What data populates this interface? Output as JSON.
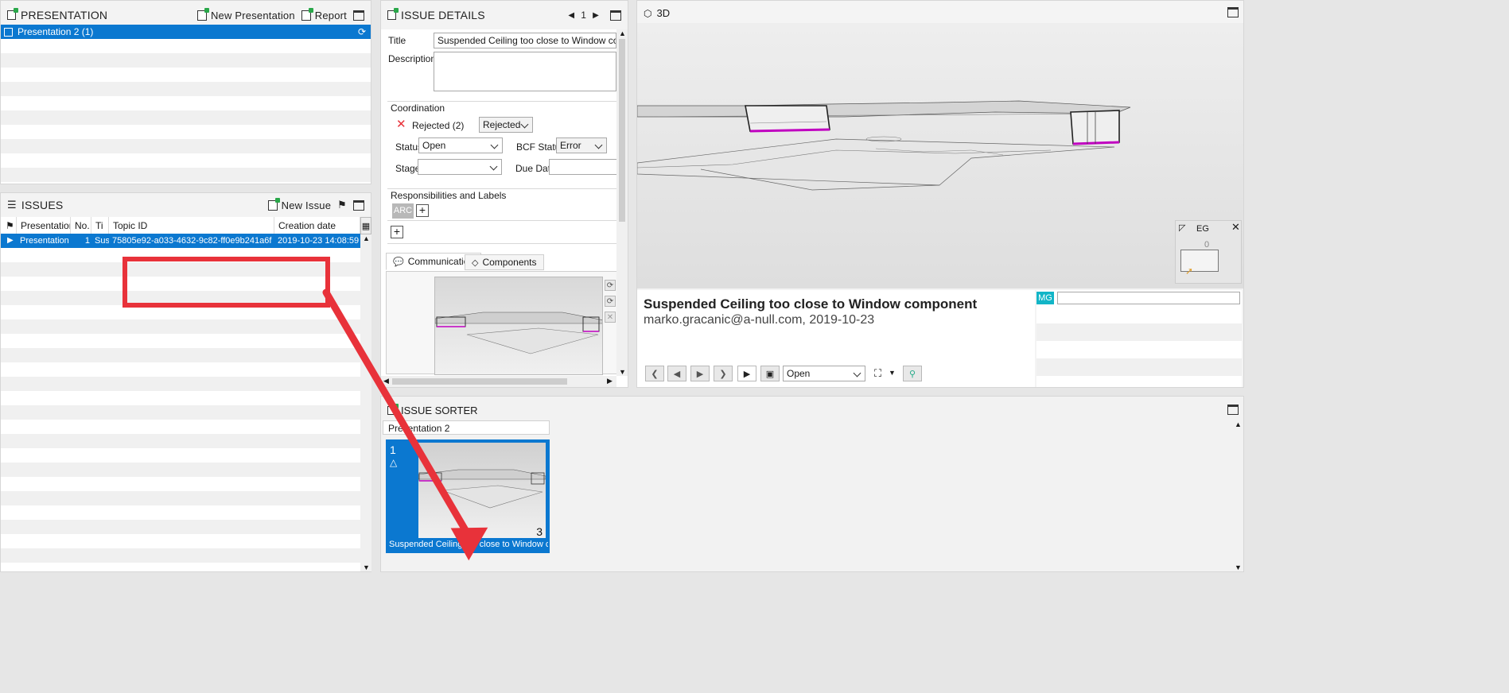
{
  "presentation_panel": {
    "title": "PRESENTATION",
    "new_presentation": "New Presentation",
    "report": "Report",
    "items": [
      "Presentation 2 (1)"
    ]
  },
  "issues_panel": {
    "title": "ISSUES",
    "new_issue": "New Issue",
    "columns": [
      "Presentation",
      "No.",
      "Ti",
      "Topic ID",
      "Creation date"
    ],
    "rows": [
      {
        "presentation": "Presentation 2",
        "no": "1",
        "title": "Sus",
        "topic_id": "75805e92-a033-4632-9c82-ff0e9b241a6f",
        "created": "2019-10-23 14:08:59"
      }
    ]
  },
  "issue_details": {
    "title": "ISSUE DETAILS",
    "page": "1",
    "title_label": "Title",
    "title_value": "Suspended Ceiling too close to Window component",
    "description_label": "Description",
    "description_value": "",
    "coordination_header": "Coordination",
    "coordination_state": "Rejected (2)",
    "coordination_select": "Rejected",
    "status_label": "Status",
    "status_value": "Open",
    "bcf_status_label": "BCF Status",
    "bcf_status_value": "Error",
    "stage_label": "Stage",
    "stage_value": "",
    "due_date_label": "Due Date",
    "due_date_value": "",
    "responsibilities_header": "Responsibilities and Labels",
    "responsibility_tag": "ARC",
    "tabs": [
      "Communication",
      "Components"
    ]
  },
  "view3d": {
    "title": "3D",
    "navigator_label": "EG",
    "navigator_level": "0",
    "issue_title": "Suspended Ceiling too close to Window component",
    "issue_meta": "marko.gracanic@a-null.com, 2019-10-23",
    "status_select": "Open",
    "user_badge": "MG",
    "comment_input": ""
  },
  "issue_sorter": {
    "title": "ISSUE SORTER",
    "group": "Presentation 2",
    "card_number": "1",
    "card_count": "3",
    "card_caption": "Suspended Ceiling too close to Window co..."
  },
  "colors": {
    "selection": "#0b78d0",
    "annotation_red": "#e8323a",
    "badge_teal": "#12b5c7",
    "magenta": "#c000c0"
  }
}
